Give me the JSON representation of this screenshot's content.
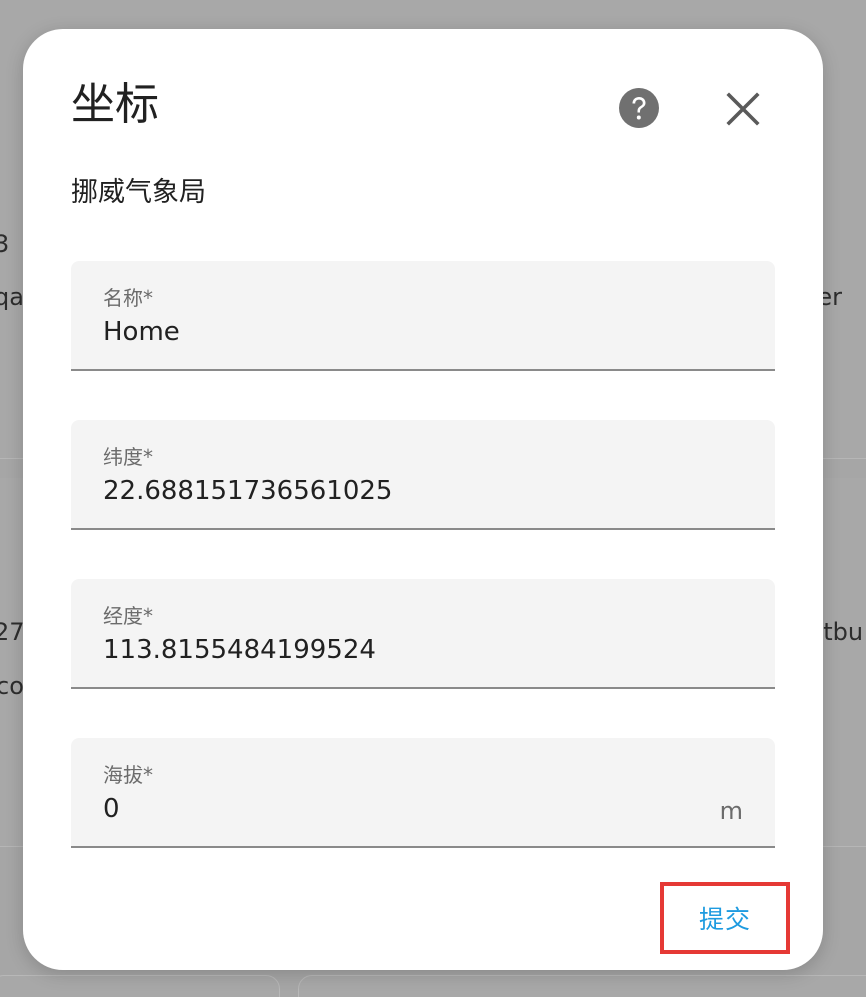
{
  "background": {
    "texts": [
      "3",
      "qa",
      "rer",
      "27",
      "col",
      "ntbu"
    ]
  },
  "dialog": {
    "title": "坐标",
    "subtitle": "挪威气象局",
    "help_icon": "help-circle-icon",
    "close_icon": "close-icon",
    "fields": [
      {
        "label": "名称*",
        "value": "Home",
        "suffix": ""
      },
      {
        "label": "纬度*",
        "value": "22.688151736561025",
        "suffix": ""
      },
      {
        "label": "经度*",
        "value": "113.8155484199524",
        "suffix": ""
      },
      {
        "label": "海拔*",
        "value": "0",
        "suffix": "m"
      }
    ],
    "submit_label": "提交"
  },
  "colors": {
    "accent": "#1e9be0",
    "highlight_border": "#e53935",
    "overlay": "#a8a8a8"
  }
}
